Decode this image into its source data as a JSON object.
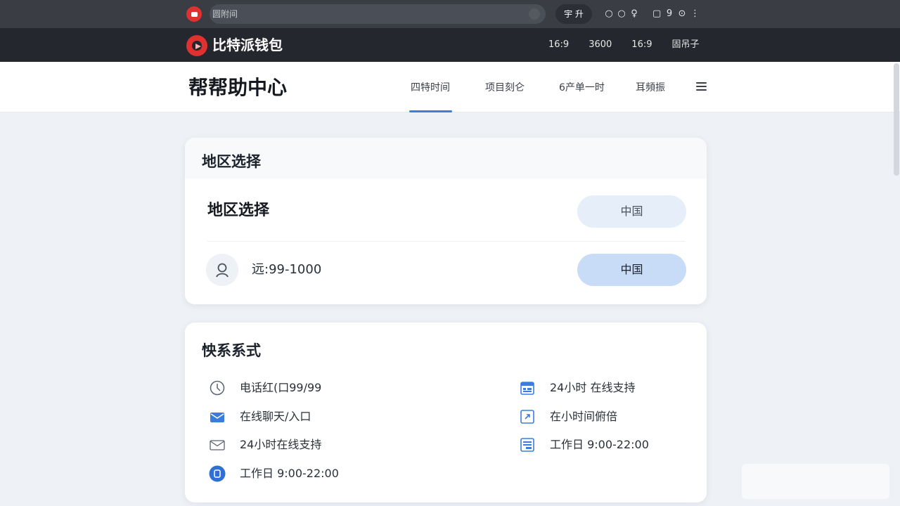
{
  "browser": {
    "address_text": "圆附间",
    "action_button": "宇 升",
    "icons": [
      "circle-icon",
      "circle-icon",
      "pin-icon",
      "window-icon",
      "bell-icon",
      "dot-circle-icon",
      "more-icon"
    ]
  },
  "site": {
    "brand": "比特派钱包",
    "header_links": [
      "16:9",
      "3600",
      "16:9",
      "固吊子"
    ]
  },
  "help": {
    "title": "帮帮助中心",
    "tabs": [
      {
        "label": "四特时间",
        "active": true
      },
      {
        "label": "项目刻仑",
        "active": false
      },
      {
        "label": "6产单一时",
        "active": false
      },
      {
        "label": "耳頻振",
        "active": false
      }
    ]
  },
  "region": {
    "card_title": "地区选择",
    "row_title": "地区选择",
    "selected_light": "中国",
    "value": "远:99-1000",
    "selected_blue": "中国"
  },
  "contact": {
    "card_title": "怏系系式",
    "left_items": [
      {
        "icon": "clock-icon",
        "text": "电话红(口99/99"
      },
      {
        "icon": "chat-icon",
        "text": "在线聊天/入口"
      },
      {
        "icon": "mail-icon",
        "text": "24小时在线支持"
      },
      {
        "icon": "badge-icon",
        "text": "工作日 9:00-22:00"
      }
    ],
    "right_items": [
      {
        "icon": "calendar-icon",
        "text": "24小时 在线支持"
      },
      {
        "icon": "expand-icon",
        "text": "在小时间俯倍"
      },
      {
        "icon": "document-icon",
        "text": "工作日 9:00-22:00"
      }
    ]
  },
  "colors": {
    "accent": "#3b7ddd",
    "brand_red": "#e03131",
    "header_bg": "#24272d",
    "page_bg": "#eef2f6"
  }
}
